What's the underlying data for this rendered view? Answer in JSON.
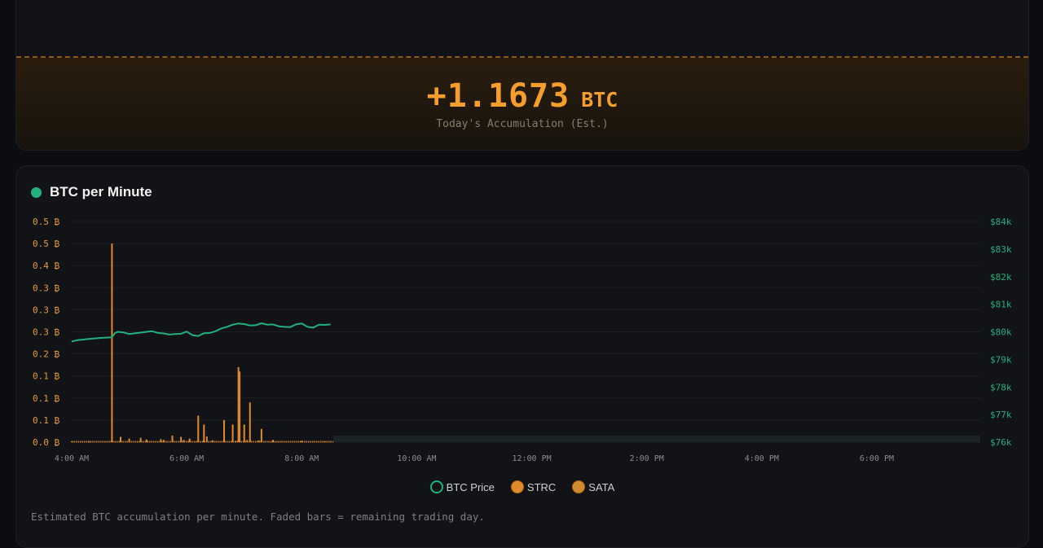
{
  "accumulation": {
    "value": "+1.1673",
    "unit": "BTC",
    "label": "Today's Accumulation (Est.)"
  },
  "chart_card": {
    "title": "BTC per Minute",
    "footnote": "Estimated BTC accumulation per minute. Faded bars = remaining trading day."
  },
  "legend": [
    {
      "label": "BTC Price",
      "color": "#22b07d",
      "style": "ring"
    },
    {
      "label": "STRC",
      "color": "#e08a2a",
      "style": "filled"
    },
    {
      "label": "SATA",
      "color": "#d08a30",
      "style": "filled"
    }
  ],
  "chart_data": {
    "type": "bar",
    "left_axis": {
      "ticks": [
        "0.5 ₿",
        "0.5 ₿",
        "0.4 ₿",
        "0.3 ₿",
        "0.3 ₿",
        "0.3 ₿",
        "0.2 ₿",
        "0.1 ₿",
        "0.1 ₿",
        "0.1 ₿",
        "0.0 ₿"
      ],
      "ylim": [
        0,
        0.5
      ]
    },
    "right_axis": {
      "ticks": [
        "$84k",
        "$83k",
        "$82k",
        "$81k",
        "$80k",
        "$79k",
        "$78k",
        "$77k",
        "$76k"
      ],
      "ylim": [
        76000,
        84000
      ]
    },
    "x_axis": {
      "ticks": [
        "4:00 AM",
        "6:00 AM",
        "8:00 AM",
        "10:00 AM",
        "12:00 PM",
        "2:00 PM",
        "4:00 PM",
        "6:00 PM"
      ],
      "range_hours": [
        4,
        19.8
      ],
      "current_hour": 8.55
    },
    "series": [
      {
        "name": "BTC Price",
        "kind": "line",
        "axis": "right",
        "x": [
          4.0,
          4.1,
          4.2,
          4.3,
          4.4,
          4.5,
          4.6,
          4.7,
          4.75,
          4.8,
          4.9,
          5.0,
          5.1,
          5.2,
          5.3,
          5.4,
          5.5,
          5.6,
          5.7,
          5.8,
          5.9,
          6.0,
          6.1,
          6.2,
          6.3,
          6.4,
          6.5,
          6.6,
          6.7,
          6.8,
          6.9,
          7.0,
          7.1,
          7.2,
          7.3,
          7.4,
          7.5,
          7.6,
          7.7,
          7.8,
          7.9,
          8.0,
          8.1,
          8.2,
          8.3,
          8.4,
          8.5
        ],
        "values": [
          79650,
          79700,
          79720,
          79740,
          79760,
          79780,
          79790,
          79800,
          79950,
          80000,
          79980,
          79920,
          79950,
          79970,
          80000,
          80020,
          79960,
          79940,
          79900,
          79920,
          79930,
          80010,
          79880,
          79850,
          79950,
          79960,
          80020,
          80120,
          80180,
          80260,
          80300,
          80280,
          80230,
          80240,
          80310,
          80260,
          80270,
          80200,
          80180,
          80170,
          80270,
          80300,
          80180,
          80150,
          80260,
          80250,
          80270
        ]
      },
      {
        "name": "STRC",
        "kind": "bar",
        "axis": "left",
        "x": [
          4.0,
          4.3,
          4.7,
          4.85,
          5.0,
          5.3,
          5.6,
          5.75,
          5.9,
          6.05,
          6.2,
          6.3,
          6.45,
          6.65,
          6.8,
          6.9,
          6.92,
          7.0,
          7.1,
          7.3,
          7.5,
          8.0,
          8.4
        ],
        "values": [
          0.002,
          0.001,
          0.45,
          0.012,
          0.008,
          0.006,
          0.005,
          0.015,
          0.012,
          0.008,
          0.06,
          0.04,
          0.004,
          0.05,
          0.04,
          0.17,
          0.16,
          0.04,
          0.09,
          0.03,
          0.005,
          0.003,
          0.002
        ]
      },
      {
        "name": "SATA",
        "kind": "bar",
        "axis": "left",
        "x": [
          5.2,
          5.55,
          5.95,
          6.35,
          6.85,
          7.05,
          7.25
        ],
        "values": [
          0.01,
          0.007,
          0.005,
          0.013,
          0.003,
          0.005,
          0.004
        ]
      }
    ]
  }
}
